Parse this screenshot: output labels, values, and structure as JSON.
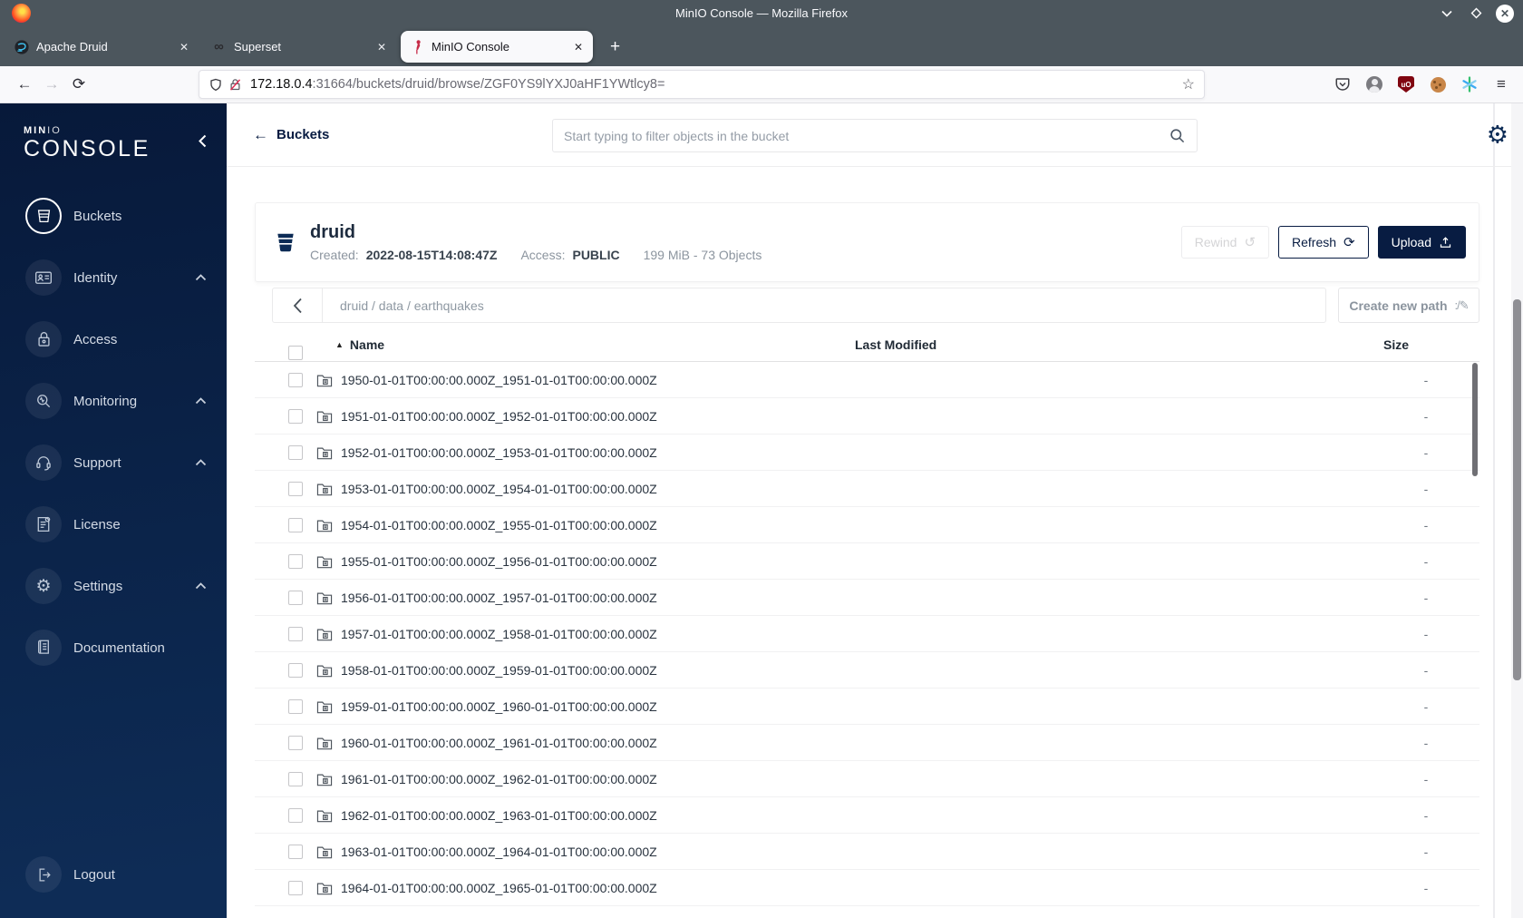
{
  "window": {
    "title": "MinIO Console — Mozilla Firefox"
  },
  "browser": {
    "tabs": [
      {
        "label": "Apache Druid",
        "favicon": "druid-favicon",
        "close": "✕",
        "active": false
      },
      {
        "label": "Superset",
        "favicon": "superset-favicon",
        "close": "✕",
        "active": false
      },
      {
        "label": "MinIO Console",
        "favicon": "minio-favicon",
        "close": "✕",
        "active": true
      }
    ],
    "new_tab_label": "+",
    "back": "←",
    "forward": "→",
    "reload": "⟳",
    "url_host": "172.18.0.4",
    "url_rest": ":31664/buckets/druid/browse/ZGF0YS9lYXJ0aHF1YWtlcy8=",
    "bookmark_star": "☆",
    "menu_glyph": "≡"
  },
  "sidebar": {
    "logo_min": "MIN",
    "logo_io": "IO",
    "logo_console": "CONSOLE",
    "items": [
      {
        "label": "Buckets",
        "icon": "bucket-icon",
        "active": true,
        "expandable": false
      },
      {
        "label": "Identity",
        "icon": "identity-icon",
        "active": false,
        "expandable": true
      },
      {
        "label": "Access",
        "icon": "access-icon",
        "active": false,
        "expandable": false
      },
      {
        "label": "Monitoring",
        "icon": "monitoring-icon",
        "active": false,
        "expandable": true
      },
      {
        "label": "Support",
        "icon": "support-icon",
        "active": false,
        "expandable": true
      },
      {
        "label": "License",
        "icon": "license-icon",
        "active": false,
        "expandable": false
      },
      {
        "label": "Settings",
        "icon": "settings-icon",
        "active": false,
        "expandable": true
      },
      {
        "label": "Documentation",
        "icon": "documentation-icon",
        "active": false,
        "expandable": false
      }
    ],
    "logout": {
      "label": "Logout",
      "icon": "logout-icon"
    }
  },
  "header": {
    "back_label": "Buckets",
    "search_placeholder": "Start typing to filter objects in the bucket"
  },
  "bucket": {
    "name": "druid",
    "created_label": "Created:",
    "created_value": "2022-08-15T14:08:47Z",
    "access_label": "Access:",
    "access_value": "PUBLIC",
    "usage": "199 MiB - 73 Objects",
    "rewind_label": "Rewind",
    "refresh_label": "Refresh",
    "upload_label": "Upload"
  },
  "browse": {
    "path": "druid / data / earthquakes",
    "create_path_label": "Create new path"
  },
  "table": {
    "columns": [
      "Name",
      "Last Modified",
      "Size"
    ],
    "rows": [
      {
        "name": "1950-01-01T00:00:00.000Z_1951-01-01T00:00:00.000Z",
        "last_modified": "",
        "size": "-"
      },
      {
        "name": "1951-01-01T00:00:00.000Z_1952-01-01T00:00:00.000Z",
        "last_modified": "",
        "size": "-"
      },
      {
        "name": "1952-01-01T00:00:00.000Z_1953-01-01T00:00:00.000Z",
        "last_modified": "",
        "size": "-"
      },
      {
        "name": "1953-01-01T00:00:00.000Z_1954-01-01T00:00:00.000Z",
        "last_modified": "",
        "size": "-"
      },
      {
        "name": "1954-01-01T00:00:00.000Z_1955-01-01T00:00:00.000Z",
        "last_modified": "",
        "size": "-"
      },
      {
        "name": "1955-01-01T00:00:00.000Z_1956-01-01T00:00:00.000Z",
        "last_modified": "",
        "size": "-"
      },
      {
        "name": "1956-01-01T00:00:00.000Z_1957-01-01T00:00:00.000Z",
        "last_modified": "",
        "size": "-"
      },
      {
        "name": "1957-01-01T00:00:00.000Z_1958-01-01T00:00:00.000Z",
        "last_modified": "",
        "size": "-"
      },
      {
        "name": "1958-01-01T00:00:00.000Z_1959-01-01T00:00:00.000Z",
        "last_modified": "",
        "size": "-"
      },
      {
        "name": "1959-01-01T00:00:00.000Z_1960-01-01T00:00:00.000Z",
        "last_modified": "",
        "size": "-"
      },
      {
        "name": "1960-01-01T00:00:00.000Z_1961-01-01T00:00:00.000Z",
        "last_modified": "",
        "size": "-"
      },
      {
        "name": "1961-01-01T00:00:00.000Z_1962-01-01T00:00:00.000Z",
        "last_modified": "",
        "size": "-"
      },
      {
        "name": "1962-01-01T00:00:00.000Z_1963-01-01T00:00:00.000Z",
        "last_modified": "",
        "size": "-"
      },
      {
        "name": "1963-01-01T00:00:00.000Z_1964-01-01T00:00:00.000Z",
        "last_modified": "",
        "size": "-"
      },
      {
        "name": "1964-01-01T00:00:00.000Z_1965-01-01T00:00:00.000Z",
        "last_modified": "",
        "size": "-"
      }
    ]
  },
  "colors": {
    "navy": "#081C42",
    "sidebar_top": "#07193A",
    "sidebar_bottom": "#0E2C56",
    "titlebar": "#4C565D",
    "active_tab_bg": "#F9F9FB"
  }
}
